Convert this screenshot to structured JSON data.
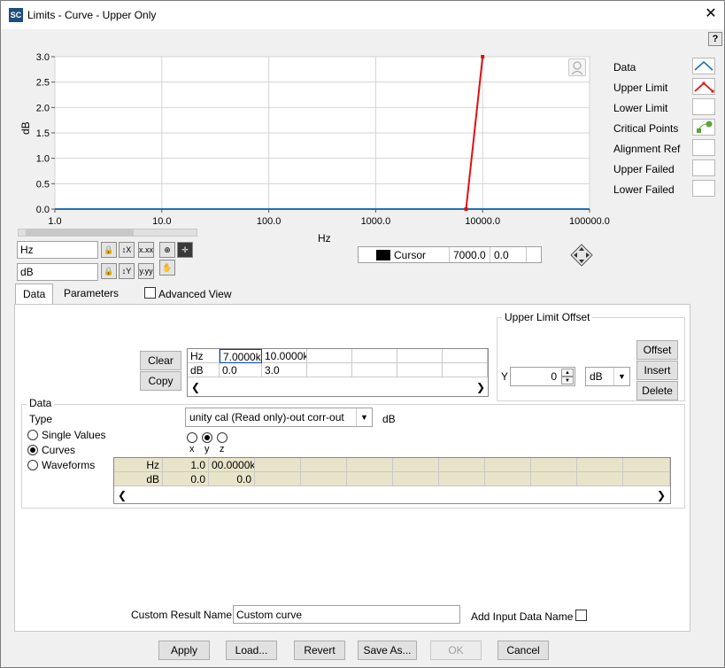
{
  "window": {
    "app_icon": "SC",
    "title": "Limits  - Curve - Upper Only",
    "close_glyph": "✕",
    "help_glyph": "?"
  },
  "chart_data": {
    "type": "line",
    "xscale": "log",
    "xlim": [
      1.0,
      100000.0
    ],
    "ylim": [
      0.0,
      3.0
    ],
    "xlabel": "Hz",
    "ylabel": "dB",
    "x_ticks": [
      "1.0",
      "10.0",
      "100.0",
      "1000.0",
      "10000.0",
      "100000.0"
    ],
    "y_ticks": [
      "0.0",
      "0.5",
      "1.0",
      "1.5",
      "2.0",
      "2.5",
      "3.0"
    ],
    "series": [
      {
        "name": "Data",
        "color": "#1f6fb5",
        "x": [
          1.0,
          100000.0
        ],
        "y": [
          0.0,
          0.0
        ]
      },
      {
        "name": "Upper Limit",
        "color": "#e01010",
        "x": [
          7000.0,
          10000.0
        ],
        "y": [
          0.0,
          3.0
        ]
      }
    ],
    "grid": true
  },
  "legend": [
    {
      "label": "Data",
      "icon": "data-line-icon"
    },
    {
      "label": "Upper Limit",
      "icon": "upper-limit-icon"
    },
    {
      "label": "Lower Limit",
      "icon": ""
    },
    {
      "label": "Critical Points",
      "icon": "critical-points-icon"
    },
    {
      "label": "Alignment Ref",
      "icon": ""
    },
    {
      "label": "Upper Failed",
      "icon": ""
    },
    {
      "label": "Lower Failed",
      "icon": ""
    }
  ],
  "axis_units": {
    "x": "Hz",
    "y": "dB"
  },
  "cursor": {
    "label": "Cursor",
    "x_value": "7000.0",
    "y_value": "0.0"
  },
  "tabs": [
    {
      "label": "Data"
    },
    {
      "label": "Parameters"
    }
  ],
  "advanced_view": {
    "label": "Advanced View",
    "checked": false
  },
  "buttons": {
    "clear": "Clear",
    "copy": "Copy",
    "offset": "Offset",
    "insert": "Insert",
    "delete": "Delete"
  },
  "limit_table": {
    "row_headers": [
      "Hz",
      "dB"
    ],
    "rows": [
      [
        "7.0000k",
        "10.0000k",
        "",
        "",
        "",
        ""
      ],
      [
        "0.0",
        "3.0",
        "",
        "",
        "",
        ""
      ]
    ]
  },
  "upper_limit_offset": {
    "title": "Upper Limit Offset",
    "axis": "Y",
    "value": "0",
    "unit": "dB"
  },
  "data_group": {
    "title": "Data",
    "type_label": "Type",
    "type_value": "unity cal (Read only)-out corr-out",
    "type_unit": "dB",
    "modes": [
      {
        "label": "Single Values",
        "selected": false
      },
      {
        "label": "Curves",
        "selected": true
      },
      {
        "label": "Waveforms",
        "selected": false
      }
    ],
    "axes": [
      {
        "label": "x",
        "selected": false
      },
      {
        "label": "y",
        "selected": true
      },
      {
        "label": "z",
        "selected": false
      }
    ],
    "table": {
      "row_headers": [
        "Hz",
        "dB"
      ],
      "rows": [
        [
          "1.0",
          "00.0000k"
        ],
        [
          "0.0",
          "0.0"
        ]
      ]
    }
  },
  "custom_result": {
    "label": "Custom Result Name",
    "value": "Custom curve"
  },
  "add_input": {
    "label": "Add Input Data Name",
    "checked": false
  },
  "footer": {
    "apply": "Apply",
    "load": "Load...",
    "revert": "Revert",
    "save_as": "Save As...",
    "ok": "OK",
    "cancel": "Cancel"
  }
}
